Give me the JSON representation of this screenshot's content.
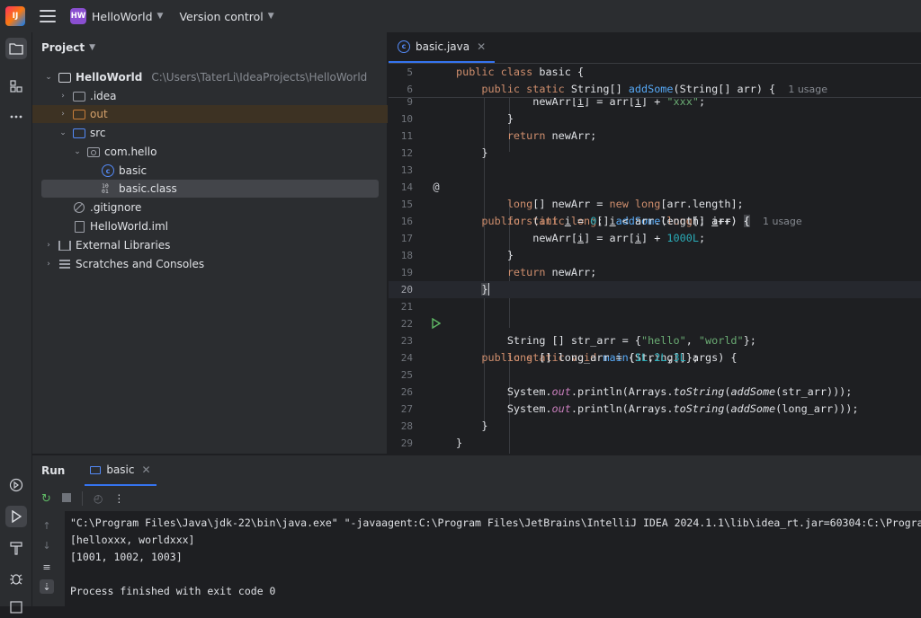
{
  "titlebar": {
    "logo_text": "IJ",
    "project_badge": "HW",
    "project_name": "HelloWorld",
    "vcs_label": "Version control"
  },
  "project_panel": {
    "title": "Project",
    "items": [
      {
        "label": "HelloWorld",
        "path": "C:\\Users\\TaterLi\\IdeaProjects\\HelloWorld"
      },
      {
        "label": ".idea"
      },
      {
        "label": "out"
      },
      {
        "label": "src"
      },
      {
        "label": "com.hello"
      },
      {
        "label": "basic"
      },
      {
        "label": "basic.class"
      },
      {
        "label": ".gitignore"
      },
      {
        "label": "HelloWorld.iml"
      },
      {
        "label": "External Libraries"
      },
      {
        "label": "Scratches and Consoles"
      }
    ]
  },
  "editor": {
    "tab_label": "basic.java",
    "usage_hint_1": "1 usage",
    "usage_hint_2": "1 usage",
    "current_line": 20,
    "line_numbers": [
      "5",
      "6",
      "9",
      "10",
      "11",
      "12",
      "13",
      "14",
      "15",
      "16",
      "17",
      "18",
      "19",
      "20",
      "21",
      "22",
      "23",
      "24",
      "25",
      "26",
      "27",
      "28",
      "29"
    ]
  },
  "run_panel": {
    "title": "Run",
    "tab_label": "basic",
    "console_lines": [
      "\"C:\\Program Files\\Java\\jdk-22\\bin\\java.exe\" \"-javaagent:C:\\Program Files\\JetBrains\\IntelliJ IDEA 2024.1.1\\lib\\idea_rt.jar=60304:C:\\Progra",
      "[helloxxx, worldxxx]",
      "[1001, 1002, 1003]",
      "",
      "Process finished with exit code 0"
    ]
  },
  "colors": {
    "accent": "#3574f0",
    "keyword": "#cf8e6d",
    "function": "#56a8f5",
    "string": "#6aab73",
    "number": "#2aacb8",
    "project_badge": "#8a4fd0"
  }
}
